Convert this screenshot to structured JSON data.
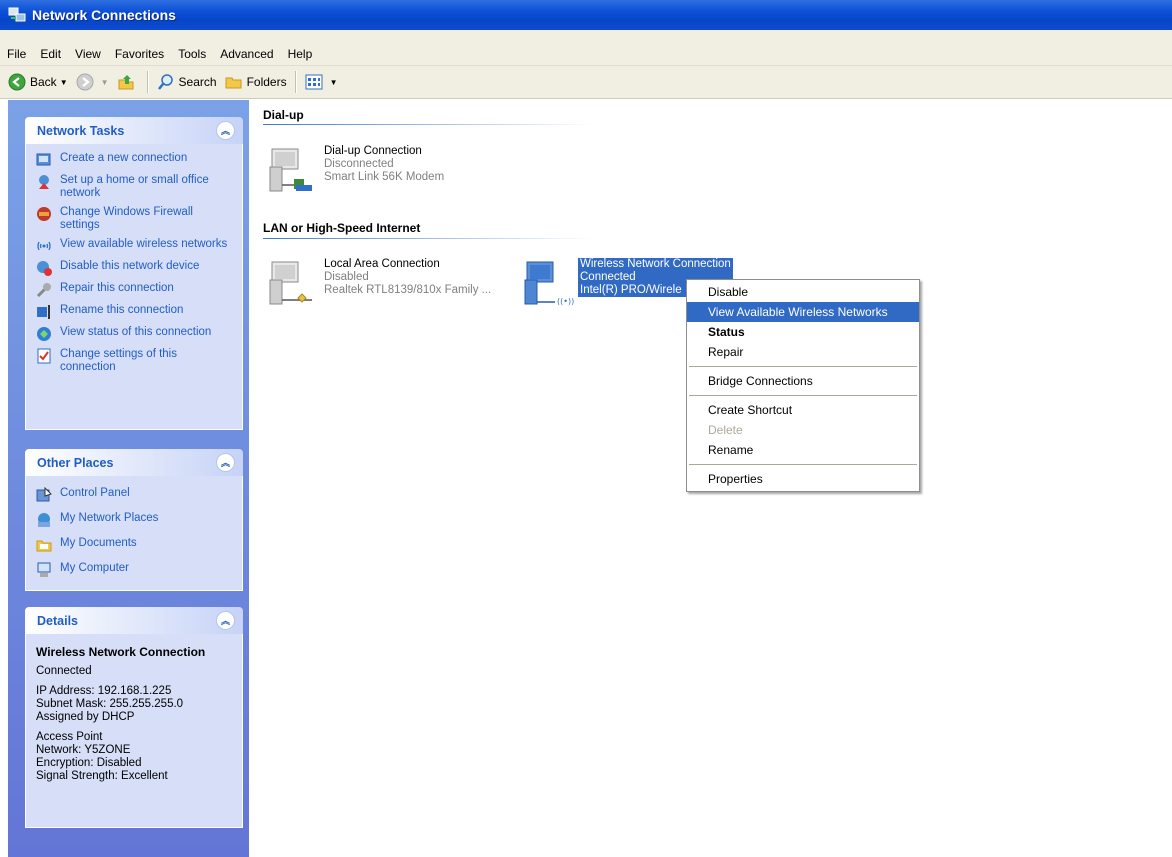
{
  "window": {
    "title": "Network Connections"
  },
  "menu": [
    "File",
    "Edit",
    "View",
    "Favorites",
    "Tools",
    "Advanced",
    "Help"
  ],
  "toolbar": {
    "back": "Back",
    "search": "Search",
    "folders": "Folders"
  },
  "tasks": {
    "title": "Network Tasks",
    "items": [
      "Create a new connection",
      "Set up a home or small office network",
      "Change Windows Firewall settings",
      "View available wireless networks",
      "Disable this network device",
      "Repair this connection",
      "Rename this connection",
      "View status of this connection",
      "Change settings of this connection"
    ]
  },
  "other": {
    "title": "Other Places",
    "items": [
      "Control Panel",
      "My Network Places",
      "My Documents",
      "My Computer"
    ]
  },
  "details": {
    "title": "Details",
    "name": "Wireless Network Connection",
    "status": "Connected",
    "ip": "IP Address: 192.168.1.225",
    "mask": "Subnet Mask: 255.255.255.0",
    "assigned": "Assigned by DHCP",
    "ap": "Access Point",
    "network": "Network: Y5ZONE",
    "encryption": "Encryption: Disabled",
    "signal": "Signal Strength: Excellent"
  },
  "groups": {
    "dialup": "Dial-up",
    "lan": "LAN or High-Speed Internet"
  },
  "connections": {
    "dialup": {
      "name": "Dial-up Connection",
      "status": "Disconnected",
      "device": "Smart Link 56K Modem"
    },
    "lan": {
      "name": "Local Area Connection",
      "status": "Disabled",
      "device": "Realtek RTL8139/810x Family ..."
    },
    "wireless": {
      "name": "Wireless Network Connection",
      "status": "Connected",
      "device": "Intel(R) PRO/Wirele"
    }
  },
  "context_menu": {
    "disable": "Disable",
    "view_wireless": "View Available Wireless Networks",
    "status": "Status",
    "repair": "Repair",
    "bridge": "Bridge Connections",
    "shortcut": "Create Shortcut",
    "delete": "Delete",
    "rename": "Rename",
    "properties": "Properties"
  }
}
